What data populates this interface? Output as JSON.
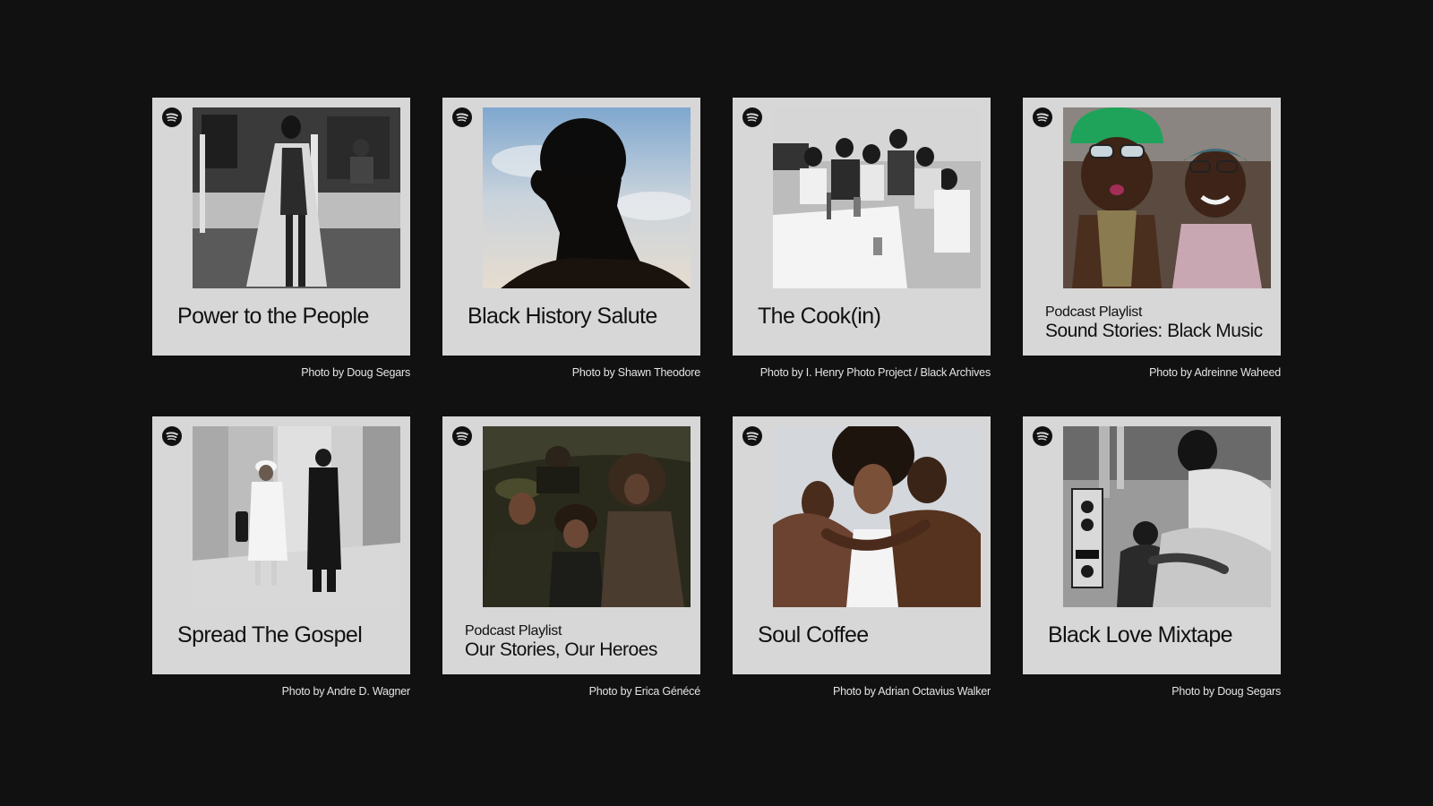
{
  "cards": [
    {
      "kind": "playlist",
      "title": "Power to the People",
      "credit": "Photo by Doug Segars",
      "icon": "spotify-icon"
    },
    {
      "kind": "playlist",
      "title": "Black History Salute",
      "credit": "Photo by Shawn Theodore",
      "icon": "spotify-icon"
    },
    {
      "kind": "playlist",
      "title": "The Cook(in)",
      "credit": "Photo by  I. Henry Photo Project / Black Archives",
      "icon": "spotify-icon"
    },
    {
      "kind": "podcast",
      "kicker": "Podcast Playlist",
      "title": "Sound Stories: Black Music",
      "credit": "Photo by Adreinne Waheed",
      "icon": "spotify-icon"
    },
    {
      "kind": "playlist",
      "title": "Spread The Gospel",
      "credit": "Photo by Andre D. Wagner",
      "icon": "spotify-icon"
    },
    {
      "kind": "podcast",
      "kicker": "Podcast Playlist",
      "title": "Our Stories, Our Heroes",
      "credit": "Photo by Erica Génécé",
      "icon": "spotify-icon"
    },
    {
      "kind": "playlist",
      "title": "Soul Coffee",
      "credit": "Photo by Adrian Octavius Walker",
      "icon": "spotify-icon"
    },
    {
      "kind": "playlist",
      "title": "Black Love Mixtape",
      "credit": "Photo by Doug Segars",
      "icon": "spotify-icon"
    }
  ],
  "colors": {
    "background": "#111112",
    "card": "#d7d7d7",
    "text_dark": "#111111",
    "credit_text": "#e4e4e4"
  }
}
